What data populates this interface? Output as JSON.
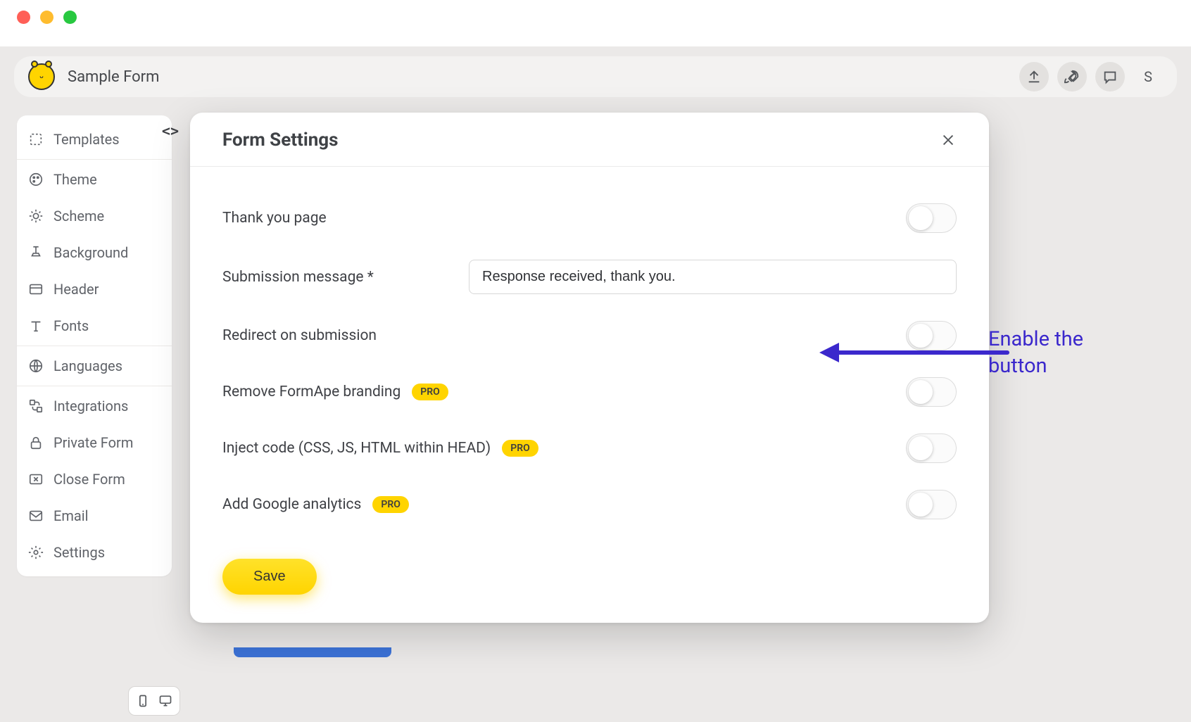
{
  "window_title": "Sample Form",
  "avatar_letter": "S",
  "sidebar": {
    "items": [
      {
        "label": "Templates"
      },
      {
        "label": "Theme"
      },
      {
        "label": "Scheme"
      },
      {
        "label": "Background"
      },
      {
        "label": "Header"
      },
      {
        "label": "Fonts"
      },
      {
        "label": "Languages"
      },
      {
        "label": "Integrations"
      },
      {
        "label": "Private Form"
      },
      {
        "label": "Close Form"
      },
      {
        "label": "Email"
      },
      {
        "label": "Settings"
      }
    ]
  },
  "modal": {
    "title": "Form Settings",
    "pro_badge": "PRO",
    "rows": {
      "thank_you": "Thank you page",
      "submission_msg_label": "Submission message *",
      "submission_msg_value": "Response received, thank you.",
      "redirect": "Redirect on submission",
      "remove_branding": "Remove FormApe branding",
      "inject_code": "Inject code (CSS, JS, HTML within HEAD)",
      "google_analytics": "Add Google analytics"
    },
    "save_label": "Save"
  },
  "annotation": {
    "line1": "Enable the",
    "line2": "button"
  }
}
